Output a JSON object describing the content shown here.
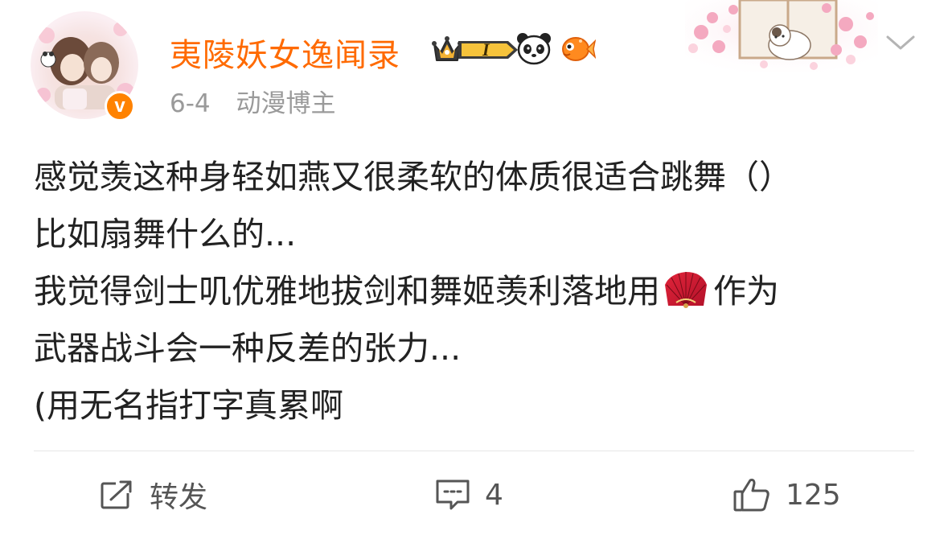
{
  "post": {
    "author": {
      "name": "夷陵妖女逸闻录",
      "verified": true,
      "verified_badge_letter": "v",
      "vip_level": "I",
      "badge_icons": [
        "crown-icon",
        "panda-icon",
        "goldfish-icon"
      ]
    },
    "meta": {
      "time": "6-4",
      "source": "动漫博主"
    },
    "content": {
      "line1": "感觉羡这种身轻如燕又很柔软的体质很适合跳舞（）",
      "line2": "比如扇舞什么的...",
      "line3_before_emoji": "我觉得剑士叽优雅地拔剑和舞姬羡利落地用",
      "line3_emoji": "folding-fan-icon",
      "line3_after_emoji": "作为",
      "line4": "武器战斗会一种反差的张力...",
      "line5": "(用无名指打字真累啊"
    },
    "actions": {
      "repost_label": "转发",
      "comment_count": "4",
      "like_count": "125"
    }
  },
  "colors": {
    "username": "#ff6a00",
    "verified_badge": "#ff8200",
    "meta_text": "#9a9a9a",
    "body_text": "#222222",
    "action_text": "#555555",
    "divider": "#e6e6e6"
  }
}
